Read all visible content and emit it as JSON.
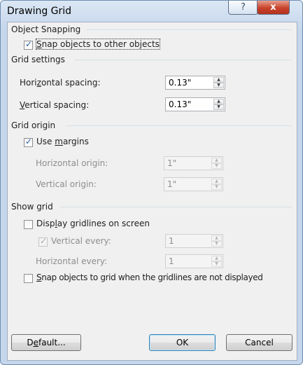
{
  "window": {
    "title": "Drawing Grid"
  },
  "titlebar": {
    "help_icon": "?",
    "close_icon": "x"
  },
  "object_snapping": {
    "heading": "Object Snapping",
    "snap_to_objects": {
      "label_pre": "",
      "label_u": "S",
      "label_post": "nap objects to other objects",
      "checked": true
    }
  },
  "grid_settings": {
    "heading": "Grid settings",
    "horizontal_spacing": {
      "label_pre": "Hori",
      "label_u": "z",
      "label_post": "ontal spacing:",
      "value": "0.13\""
    },
    "vertical_spacing": {
      "label_pre": "",
      "label_u": "V",
      "label_post": "ertical spacing:",
      "value": "0.13\""
    }
  },
  "grid_origin": {
    "heading": "Grid origin",
    "use_margins": {
      "label_pre": "Use ",
      "label_u": "m",
      "label_post": "argins",
      "checked": true
    },
    "horizontal_origin": {
      "label": "Horizontal origin:",
      "value": "1\""
    },
    "vertical_origin": {
      "label": "Vertical origin:",
      "value": "1\""
    }
  },
  "show_grid": {
    "heading": "Show grid",
    "display_gridlines": {
      "label_pre": "Disp",
      "label_u": "l",
      "label_post": "ay gridlines on screen",
      "checked": false
    },
    "vertical_every": {
      "label": "Vertical every:",
      "checked": true,
      "value": "1"
    },
    "horizontal_every": {
      "label": "Horizontal every:",
      "value": "1"
    },
    "snap_to_grid": {
      "label_pre": "",
      "label_u": "S",
      "label_post": "nap objects to grid when the gridlines are not displayed",
      "checked": false
    }
  },
  "buttons": {
    "default": {
      "label_pre": "D",
      "label_u": "e",
      "label_post": "fault..."
    },
    "ok": "OK",
    "cancel": "Cancel"
  },
  "arrows": {
    "up": "▲",
    "down": "▼"
  },
  "check_glyph": "✓"
}
